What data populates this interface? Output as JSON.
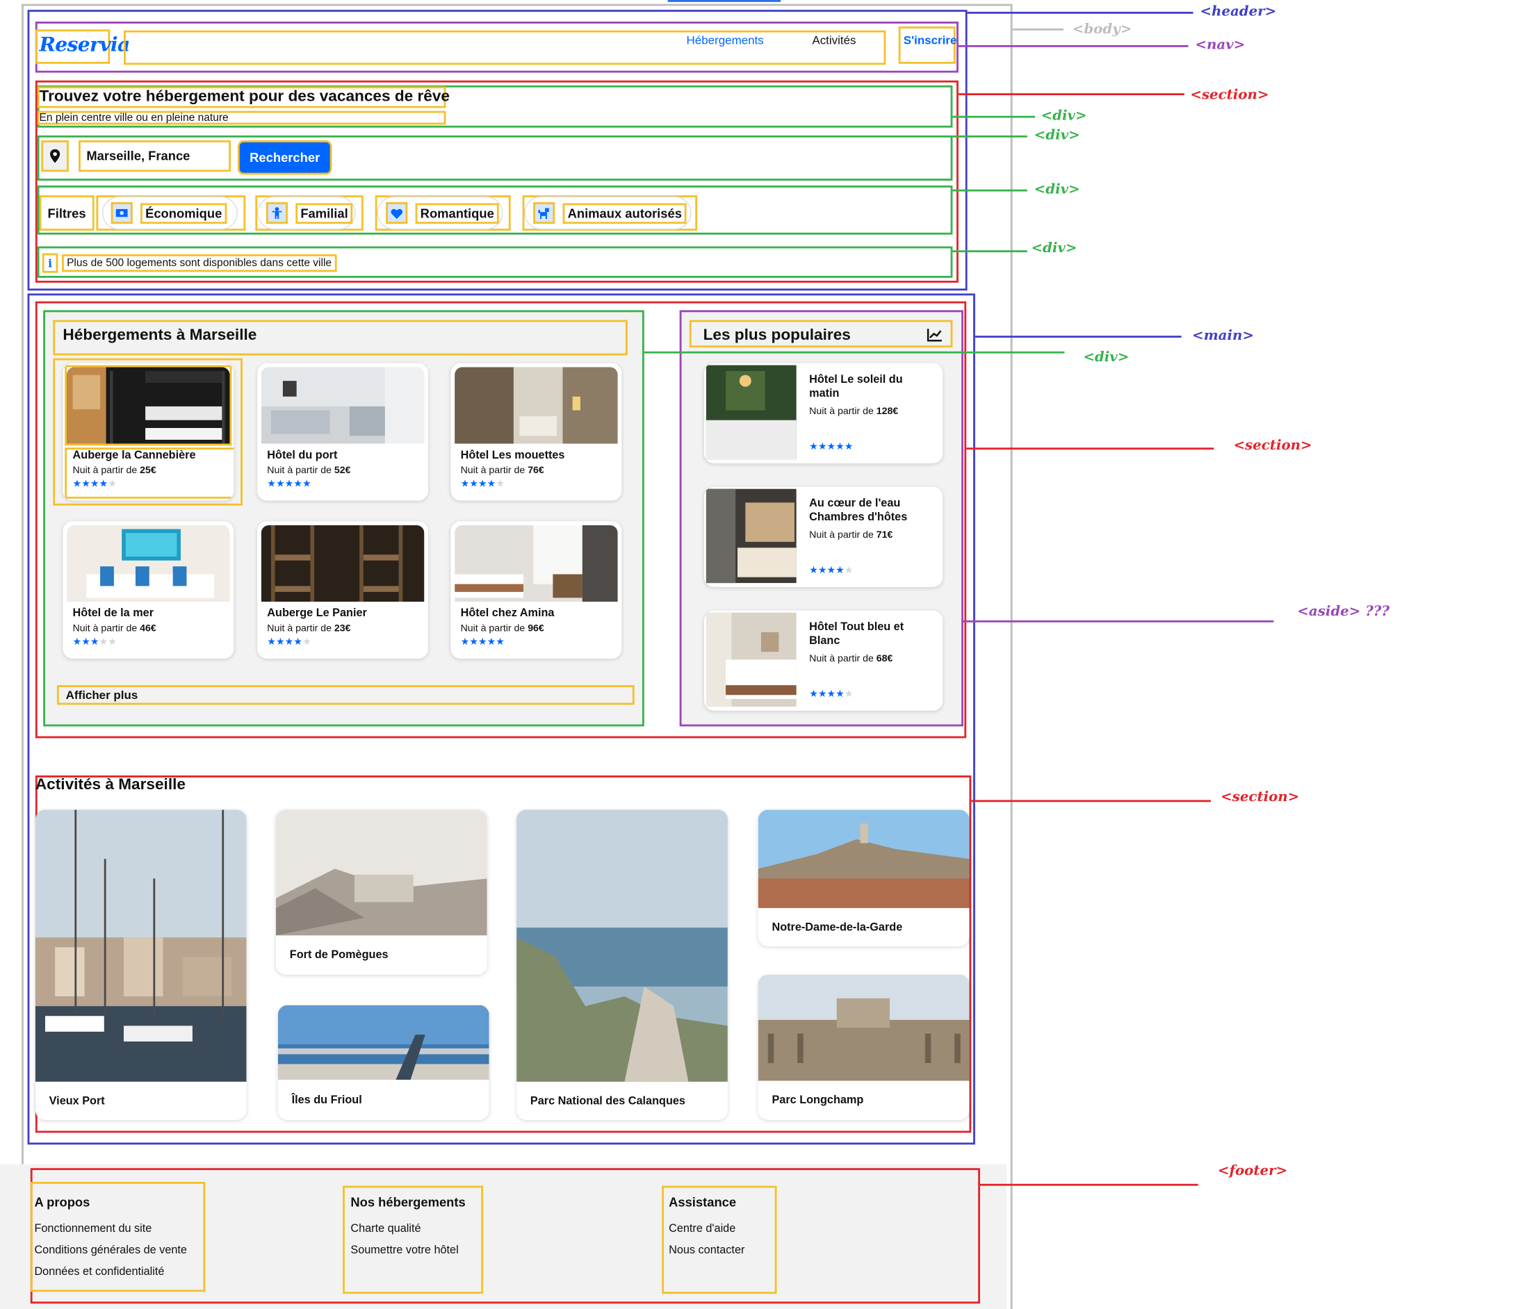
{
  "annotations": {
    "header": "<header>",
    "body": "<body>",
    "nav": "<nav>",
    "section1": "<section>",
    "div1": "<div>",
    "div2": "<div>",
    "div3": "<div>",
    "div4": "<div>",
    "main": "<main>",
    "div5": "<div>",
    "section2": "<section>",
    "aside": "<aside> ???",
    "section3": "<section>",
    "footer": "<footer>"
  },
  "nav": {
    "logo": "Reservia",
    "links": [
      "Hébergements",
      "Activités"
    ],
    "signup": "S'inscrire"
  },
  "hero": {
    "title": "Trouvez votre hébergement pour des vacances de rêve",
    "subtitle": "En plein centre ville ou en pleine nature",
    "location": "Marseille, France",
    "search_button": "Rechercher",
    "filters_label": "Filtres",
    "filters": [
      {
        "label": "Économique",
        "icon": "money-icon"
      },
      {
        "label": "Familial",
        "icon": "child-icon"
      },
      {
        "label": "Romantique",
        "icon": "heart-icon"
      },
      {
        "label": "Animaux autorisés",
        "icon": "dog-icon"
      }
    ],
    "info": "Plus de 500 logements sont disponibles dans cette ville"
  },
  "accommodations": {
    "title": "Hébergements à Marseille",
    "cards": [
      {
        "name": "Auberge la Cannebière",
        "price_prefix": "Nuit à partir de ",
        "price": "25€",
        "rating": 4
      },
      {
        "name": "Hôtel du port",
        "price_prefix": "Nuit à partir de ",
        "price": "52€",
        "rating": 5
      },
      {
        "name": "Hôtel Les mouettes",
        "price_prefix": "Nuit à partir de ",
        "price": "76€",
        "rating": 4
      },
      {
        "name": "Hôtel de la mer",
        "price_prefix": "Nuit à partir de ",
        "price": "46€",
        "rating": 3
      },
      {
        "name": "Auberge Le Panier",
        "price_prefix": "Nuit à partir de ",
        "price": "23€",
        "rating": 4
      },
      {
        "name": "Hôtel chez Amina",
        "price_prefix": "Nuit à partir de ",
        "price": "96€",
        "rating": 5
      }
    ],
    "more": "Afficher plus"
  },
  "popular": {
    "title": "Les plus populaires",
    "icon": "trend-icon",
    "cards": [
      {
        "name": "Hôtel Le soleil du matin",
        "price_prefix": "Nuit à partir de ",
        "price": "128€",
        "rating": 5
      },
      {
        "name": "Au cœur de l'eau Chambres d'hôtes",
        "price_prefix": "Nuit à partir de ",
        "price": "71€",
        "rating": 4
      },
      {
        "name": "Hôtel Tout bleu et Blanc",
        "price_prefix": "Nuit à partir de ",
        "price": "68€",
        "rating": 4
      }
    ]
  },
  "activities": {
    "title": "Activités à Marseille",
    "items": [
      "Vieux Port",
      "Fort de Pomègues",
      "Îles du Frioul",
      "Parc National des Calanques",
      "Notre-Dame-de-la-Garde",
      "Parc Longchamp"
    ]
  },
  "footer": {
    "columns": [
      {
        "title": "A propos",
        "links": [
          "Fonctionnement du site",
          "Conditions générales de vente",
          "Données et confidentialité"
        ]
      },
      {
        "title": "Nos hébergements",
        "links": [
          "Charte qualité",
          "Soumettre votre hôtel"
        ]
      },
      {
        "title": "Assistance",
        "links": [
          "Centre d'aide",
          "Nous contacter"
        ]
      }
    ]
  },
  "colors": {
    "brand": "#0066ff",
    "header_outline": "#4040c8",
    "nav_outline": "#9b45b8",
    "section_outline": "#e3242b",
    "div_outline": "#37b24d",
    "element_outline": "#f4c02c"
  }
}
